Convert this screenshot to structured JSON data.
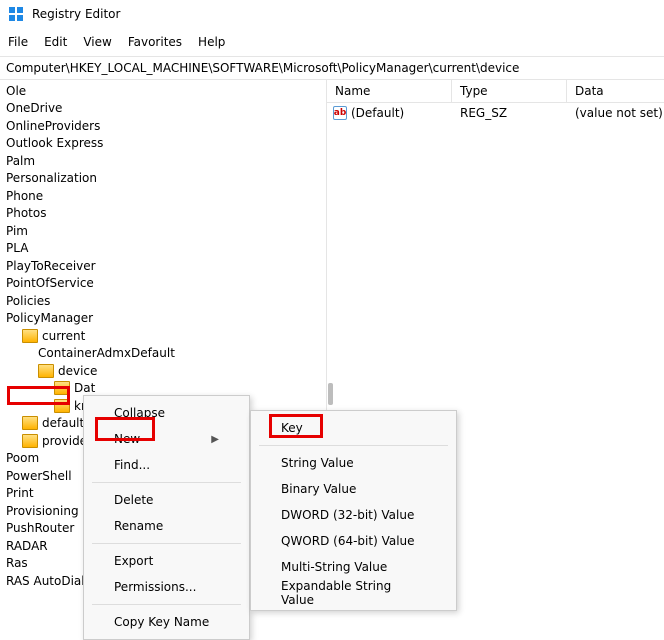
{
  "title": "Registry Editor",
  "menu": {
    "file": "File",
    "edit": "Edit",
    "view": "View",
    "favorites": "Favorites",
    "help": "Help"
  },
  "address": "Computer\\HKEY_LOCAL_MACHINE\\SOFTWARE\\Microsoft\\PolicyManager\\current\\device",
  "tree": {
    "ole": "Ole",
    "onedrive": "OneDrive",
    "onlineproviders": "OnlineProviders",
    "outlookexpress": "Outlook Express",
    "palm": "Palm",
    "personalization": "Personalization",
    "phone": "Phone",
    "photos": "Photos",
    "pim": "Pim",
    "pla": "PLA",
    "playtoreceiver": "PlayToReceiver",
    "pointofservice": "PointOfService",
    "policies": "Policies",
    "policymanager": "PolicyManager",
    "current": "current",
    "containeradmxdefault": "ContainerAdmxDefault",
    "device": "device",
    "dat": "Dat",
    "kno": "kno",
    "default": "default",
    "providers": "providers",
    "poom": "Poom",
    "powershell": "PowerShell",
    "print": "Print",
    "provisioning": "Provisioning",
    "pushrouter": "PushRouter",
    "radar": "RADAR",
    "ras": "Ras",
    "rasautodial": "RAS AutoDial"
  },
  "columns": {
    "name": "Name",
    "type": "Type",
    "data": "Data"
  },
  "row_default": {
    "name": "(Default)",
    "type": "REG_SZ",
    "data": "(value not set)",
    "icon_text": "ab"
  },
  "ctx_main": {
    "collapse": "Collapse",
    "new": "New",
    "find": "Find...",
    "delete": "Delete",
    "rename": "Rename",
    "export": "Export",
    "permissions": "Permissions...",
    "copykey": "Copy Key Name"
  },
  "ctx_sub": {
    "key": "Key",
    "string": "String Value",
    "binary": "Binary Value",
    "dword": "DWORD (32-bit) Value",
    "qword": "QWORD (64-bit) Value",
    "multistring": "Multi-String Value",
    "expandable": "Expandable String Value"
  }
}
